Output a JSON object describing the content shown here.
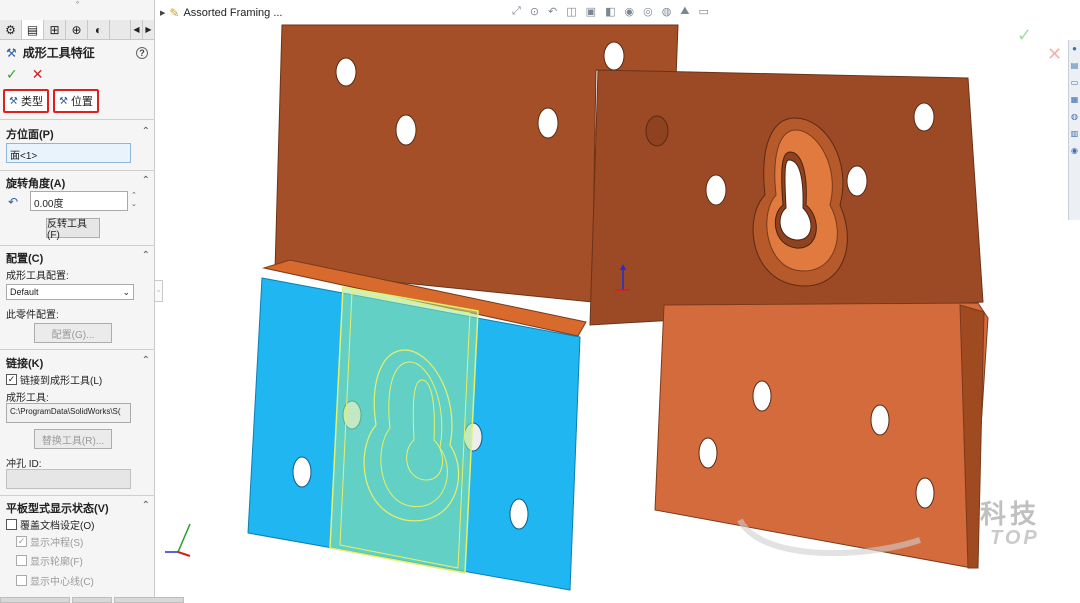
{
  "window": {
    "document_title": "Assorted Framing ..."
  },
  "pm": {
    "title": "成形工具特征",
    "ok": "✓",
    "cancel": "✕",
    "help": "?",
    "tab_type": "类型",
    "tab_position": "位置",
    "face_group": "方位面(P)",
    "face_value": "面<1>",
    "rotate_group": "旋转角度(A)",
    "rotate_value": "0.00度",
    "flip_button": "反转工具(F)",
    "config_group": "配置(C)",
    "tool_config_label": "成形工具配置:",
    "tool_config_value": "Default",
    "part_config_label": "此零件配置:",
    "config_button": "配置(G)...",
    "link_group": "链接(K)",
    "link_checkbox": "链接到成形工具(L)",
    "tool_label": "成形工具:",
    "tool_path": "C:\\ProgramData\\SolidWorks\\S(",
    "replace_button": "替换工具(R)...",
    "punch_label": "冲孔 ID:",
    "flat_group": "平板型式显示状态(V)",
    "override_checkbox": "覆盖文档设定(O)",
    "show_punch": "显示冲程(S)",
    "show_profile": "显示轮廓(F)",
    "show_center": "显示中心线(C)"
  },
  "watermark": {
    "line1": "科技",
    "line2": "TOP"
  },
  "colors": {
    "part": "#d46b3c",
    "part_dark": "#9a4a24",
    "selected_face": "#1fb6f2",
    "forming_tool": "#e6f06a",
    "accent_red": "#e0201e"
  },
  "icons": [
    "part-icon",
    "feature-icon",
    "config-icon",
    "target-icon",
    "appearance-icon",
    "assembly-icon"
  ]
}
